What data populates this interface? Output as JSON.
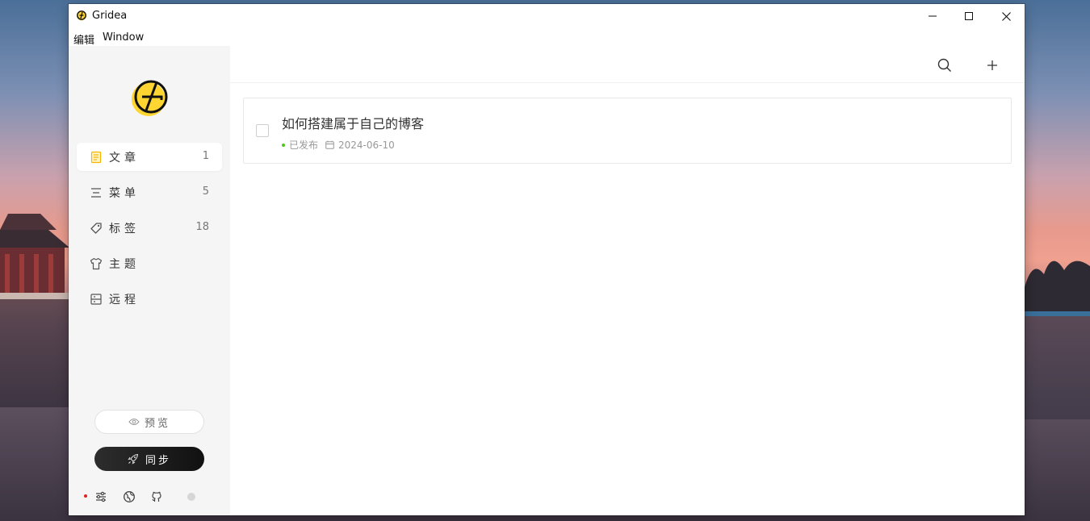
{
  "window": {
    "title": "Gridea"
  },
  "menu": [
    {
      "label": "编辑"
    },
    {
      "label": "Window"
    }
  ],
  "sidebar": {
    "items": [
      {
        "label": "文章",
        "count": "1",
        "icon": "article-icon",
        "active": true
      },
      {
        "label": "菜单",
        "count": "5",
        "icon": "menu-list-icon"
      },
      {
        "label": "标签",
        "count": "18",
        "icon": "tag-icon"
      },
      {
        "label": "主题",
        "count": "",
        "icon": "shirt-icon"
      },
      {
        "label": "远程",
        "count": "",
        "icon": "server-icon"
      }
    ],
    "preview_label": "预览",
    "sync_label": "同步"
  },
  "toolbar": {
    "search_icon": "search-icon",
    "add_icon": "plus-icon"
  },
  "posts": [
    {
      "title": "如何搭建属于自己的博客",
      "status": "已发布",
      "date": "2024-06-10"
    }
  ],
  "colors": {
    "accent": "#ffd531",
    "sync_bg": "#1f1f1f",
    "published": "#52c41a",
    "notice_dot": "#e0201e"
  }
}
